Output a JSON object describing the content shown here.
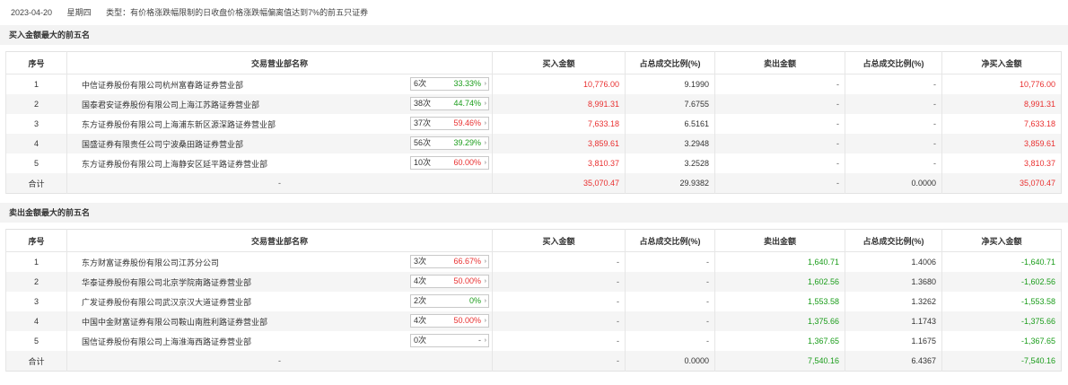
{
  "header": {
    "date": "2023-04-20",
    "weekday": "星期四",
    "type_label": "类型：有价格涨跌幅限制的日收盘价格涨跌幅偏离值达到7%的前五只证券"
  },
  "columns": [
    "序号",
    "交易营业部名称",
    "买入金额",
    "占总成交比例(%)",
    "卖出金额",
    "占总成交比例(%)",
    "净买入金额"
  ],
  "buy": {
    "title": "买入金额最大的前五名",
    "rows": [
      {
        "idx": "1",
        "name": "中信证券股份有限公司杭州富春路证券营业部",
        "count": "6次",
        "pct": "33.33%",
        "pct_color": "green",
        "buy": "10,776.00",
        "buy_ratio": "9.1990",
        "sell": "-",
        "sell_ratio": "-",
        "net": "10,776.00",
        "net_color": "red"
      },
      {
        "idx": "2",
        "name": "国泰君安证券股份有限公司上海江苏路证券营业部",
        "count": "38次",
        "pct": "44.74%",
        "pct_color": "green",
        "buy": "8,991.31",
        "buy_ratio": "7.6755",
        "sell": "-",
        "sell_ratio": "-",
        "net": "8,991.31",
        "net_color": "red"
      },
      {
        "idx": "3",
        "name": "东方证券股份有限公司上海浦东新区源深路证券营业部",
        "count": "37次",
        "pct": "59.46%",
        "pct_color": "red",
        "buy": "7,633.18",
        "buy_ratio": "6.5161",
        "sell": "-",
        "sell_ratio": "-",
        "net": "7,633.18",
        "net_color": "red"
      },
      {
        "idx": "4",
        "name": "国盛证券有限责任公司宁波桑田路证券营业部",
        "count": "56次",
        "pct": "39.29%",
        "pct_color": "green",
        "buy": "3,859.61",
        "buy_ratio": "3.2948",
        "sell": "-",
        "sell_ratio": "-",
        "net": "3,859.61",
        "net_color": "red"
      },
      {
        "idx": "5",
        "name": "东方证券股份有限公司上海静安区延平路证券营业部",
        "count": "10次",
        "pct": "60.00%",
        "pct_color": "red",
        "buy": "3,810.37",
        "buy_ratio": "3.2528",
        "sell": "-",
        "sell_ratio": "-",
        "net": "3,810.37",
        "net_color": "red"
      }
    ],
    "total": {
      "idx": "合计",
      "name": "-",
      "buy": "35,070.47",
      "buy_ratio": "29.9382",
      "sell": "-",
      "sell_ratio": "0.0000",
      "net": "35,070.47",
      "net_color": "red"
    }
  },
  "sell": {
    "title": "卖出金额最大的前五名",
    "rows": [
      {
        "idx": "1",
        "name": "东方财富证券股份有限公司江苏分公司",
        "count": "3次",
        "pct": "66.67%",
        "pct_color": "red",
        "buy": "-",
        "buy_ratio": "-",
        "sell": "1,640.71",
        "sell_ratio": "1.4006",
        "net": "-1,640.71",
        "net_color": "green"
      },
      {
        "idx": "2",
        "name": "华泰证券股份有限公司北京学院南路证券营业部",
        "count": "4次",
        "pct": "50.00%",
        "pct_color": "red",
        "buy": "-",
        "buy_ratio": "-",
        "sell": "1,602.56",
        "sell_ratio": "1.3680",
        "net": "-1,602.56",
        "net_color": "green"
      },
      {
        "idx": "3",
        "name": "广发证券股份有限公司武汉京汉大道证券营业部",
        "count": "2次",
        "pct": "0%",
        "pct_color": "green",
        "buy": "-",
        "buy_ratio": "-",
        "sell": "1,553.58",
        "sell_ratio": "1.3262",
        "net": "-1,553.58",
        "net_color": "green"
      },
      {
        "idx": "4",
        "name": "中国中金财富证券有限公司鞍山南胜利路证券营业部",
        "count": "4次",
        "pct": "50.00%",
        "pct_color": "red",
        "buy": "-",
        "buy_ratio": "-",
        "sell": "1,375.66",
        "sell_ratio": "1.1743",
        "net": "-1,375.66",
        "net_color": "green"
      },
      {
        "idx": "5",
        "name": "国信证券股份有限公司上海淮海西路证券营业部",
        "count": "0次",
        "pct": "-",
        "pct_color": "dash",
        "buy": "-",
        "buy_ratio": "-",
        "sell": "1,367.65",
        "sell_ratio": "1.1675",
        "net": "-1,367.65",
        "net_color": "green"
      }
    ],
    "total": {
      "idx": "合计",
      "name": "-",
      "buy": "-",
      "buy_ratio": "0.0000",
      "sell": "7,540.16",
      "sell_ratio": "6.4367",
      "net": "-7,540.16",
      "net_color": "green"
    }
  }
}
